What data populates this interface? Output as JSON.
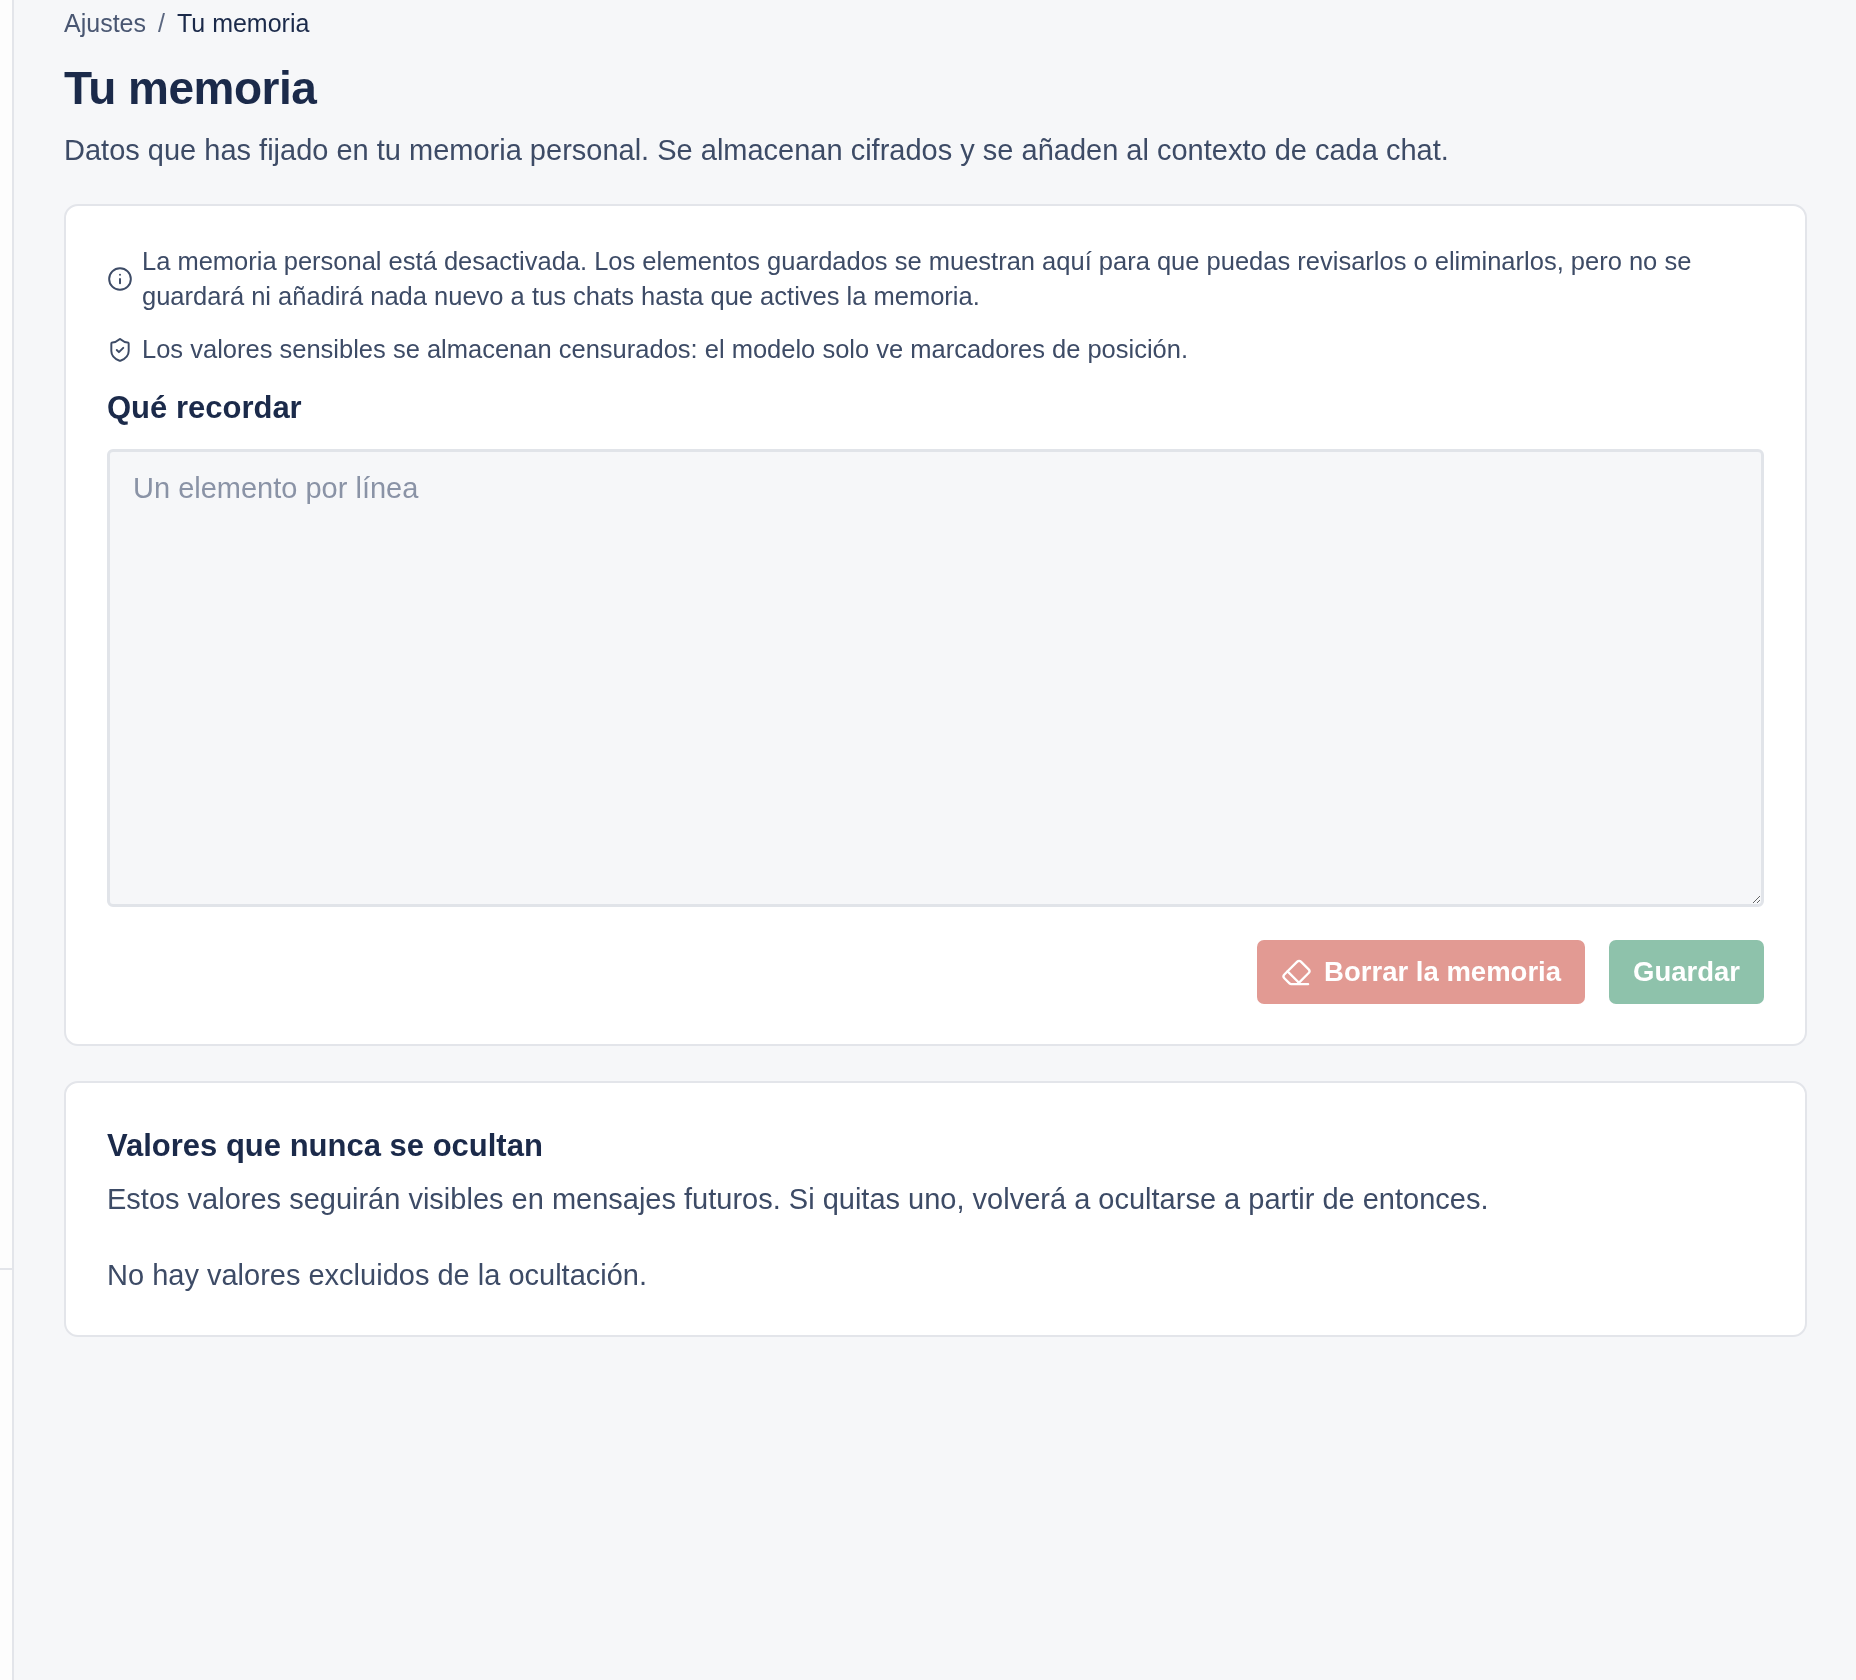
{
  "breadcrumb": {
    "items": [
      {
        "label": "Ajustes",
        "current": false
      },
      {
        "label": "Tu memoria",
        "current": true
      }
    ],
    "separator": "/"
  },
  "page": {
    "title": "Tu memoria",
    "subtitle": "Datos que has fijado en tu memoria personal. Se almacenan cifrados y se añaden al contexto de cada chat."
  },
  "memory_card": {
    "notices": [
      {
        "kind": "info",
        "text": "La memoria personal está desactivada. Los elementos guardados se muestran aquí para que puedas revisarlos o eliminarlos, pero no se guardará ni añadirá nada nuevo a tus chats hasta que actives la memoria."
      },
      {
        "kind": "privacy",
        "text": "Los valores sensibles se almacenan censurados: el modelo solo ve marcadores de posición."
      }
    ],
    "field": {
      "label": "Qué recordar",
      "placeholder": "Un elemento por línea"
    },
    "buttons": [
      {
        "kind": "danger",
        "label": "Borrar la memoria",
        "disabled": true
      },
      {
        "kind": "primary",
        "label": "Guardar",
        "disabled": true
      }
    ]
  },
  "exclusions_card": {
    "title": "Valores que nunca se ocultan",
    "description": "Estos valores seguirán visibles en mensajes futuros. Si quitas uno, volverá a ocultarse a partir de entonces.",
    "empty_text": "No hay valores excluidos de la ocultación."
  }
}
